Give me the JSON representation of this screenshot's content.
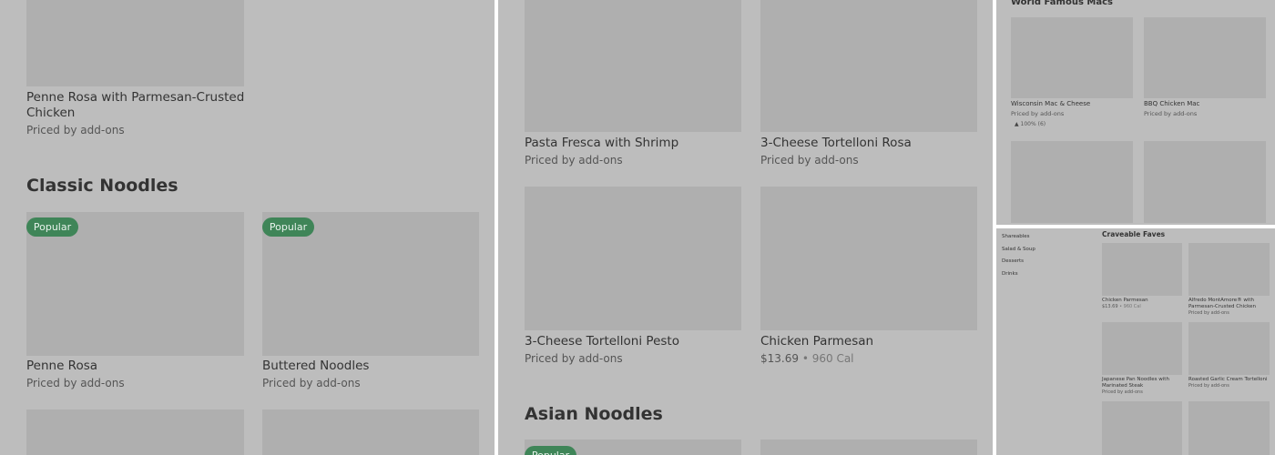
{
  "panel1": {
    "item_top": {
      "name": "Penne Rosa with Parmesan-Crusted Chicken",
      "price": "Priced by add-ons"
    },
    "section_title": "Classic Noodles",
    "items": [
      {
        "badge": "Popular",
        "name": "Penne Rosa",
        "price": "Priced by add-ons"
      },
      {
        "badge": "Popular",
        "name": "Buttered Noodles",
        "price": "Priced by add-ons"
      }
    ]
  },
  "panel2": {
    "items": [
      {
        "name": "Pasta Fresca with Shrimp",
        "price": "Priced by add-ons"
      },
      {
        "name": "3-Cheese Tortelloni Rosa",
        "price": "Priced by add-ons"
      },
      {
        "name": "3-Cheese Tortelloni Pesto",
        "price": "Priced by add-ons"
      },
      {
        "name": "Chicken Parmesan",
        "price": "$13.69",
        "calories": "960 Cal"
      }
    ],
    "section_title": "Asian Noodles",
    "badge": "Popular"
  },
  "panel3": {
    "section_title": "World Famous Macs",
    "items": [
      {
        "name": "Wisconsin Mac & Cheese",
        "price": "Priced by add-ons",
        "rating": "100% (6)"
      },
      {
        "name": "BBQ Chicken Mac",
        "price": "Priced by add-ons"
      }
    ]
  },
  "panel4": {
    "sidebar": [
      "Shareables",
      "Salad & Soup",
      "Desserts",
      "Drinks"
    ],
    "section_title": "Craveable Faves",
    "items": [
      {
        "name": "Chicken Parmesan",
        "price": "$13.69",
        "calories": "960 Cal"
      },
      {
        "name": "Alfredo MontAmore® with Parmesan-Crusted Chicken",
        "price": "Priced by add-ons"
      },
      {
        "name": "Japanese Pan Noodles with Marinated Steak",
        "price": "Priced by add-ons"
      },
      {
        "name": "Roasted Garlic Cream Tortelloni",
        "price": "Priced by add-ons"
      }
    ]
  },
  "icons": {
    "rating": "thumbs-up-icon"
  },
  "colors": {
    "overlay": "#bdbdbd",
    "tile": "#afafaf",
    "badge": "#3f8558"
  }
}
